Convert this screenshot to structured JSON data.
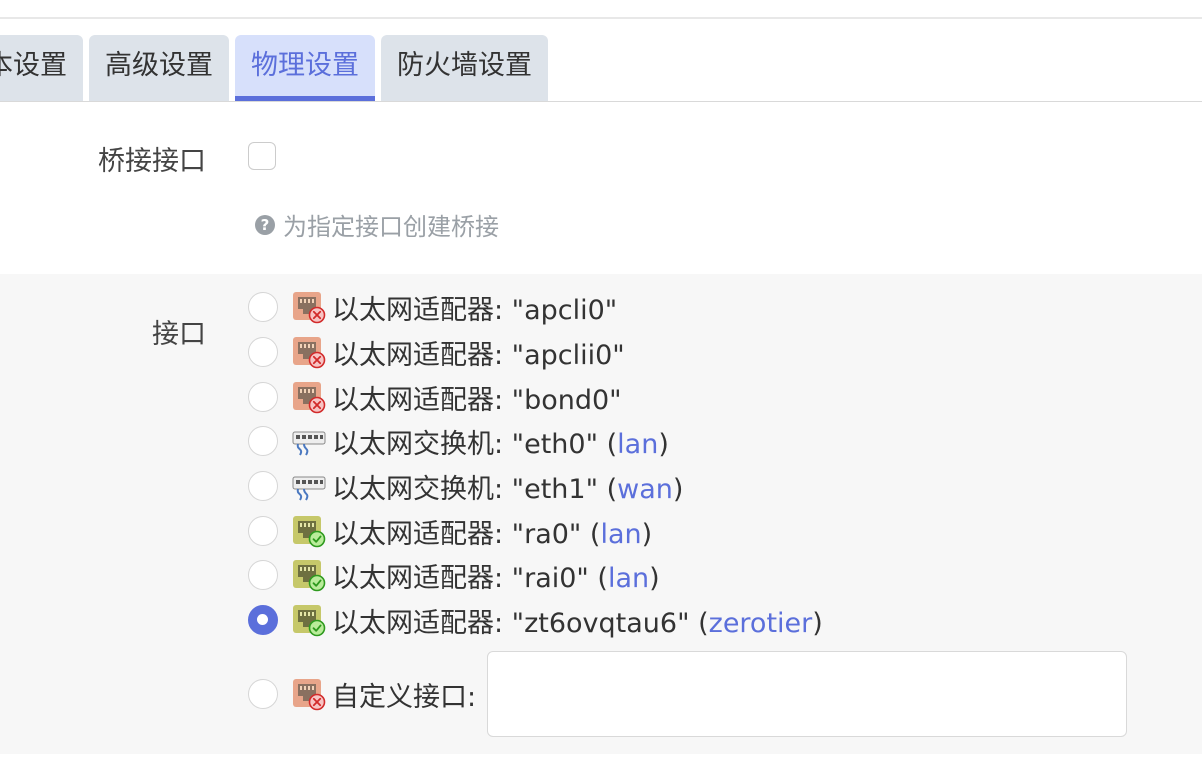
{
  "tabs": [
    {
      "label": "本设置",
      "active": false
    },
    {
      "label": "高级设置",
      "active": false
    },
    {
      "label": "物理设置",
      "active": true
    },
    {
      "label": "防火墙设置",
      "active": false
    }
  ],
  "bridge": {
    "label": "桥接接口",
    "checked": false,
    "help": "为指定接口创建桥接"
  },
  "interface": {
    "label": "接口",
    "options": [
      {
        "text": "以太网适配器: \"apcli0\"",
        "zone": "",
        "icon": "ethernet-adapter-down-icon",
        "checked": false
      },
      {
        "text": "以太网适配器: \"apclii0\"",
        "zone": "",
        "icon": "ethernet-adapter-down-icon",
        "checked": false
      },
      {
        "text": "以太网适配器: \"bond0\"",
        "zone": "",
        "icon": "ethernet-adapter-down-icon",
        "checked": false
      },
      {
        "text": "以太网交换机: \"eth0\"",
        "zone": "lan",
        "icon": "ethernet-switch-icon",
        "checked": false
      },
      {
        "text": "以太网交换机: \"eth1\"",
        "zone": "wan",
        "icon": "ethernet-switch-icon",
        "checked": false
      },
      {
        "text": "以太网适配器: \"ra0\"",
        "zone": "lan",
        "icon": "ethernet-adapter-up-icon",
        "checked": false
      },
      {
        "text": "以太网适配器: \"rai0\"",
        "zone": "lan",
        "icon": "ethernet-adapter-up-icon",
        "checked": false
      },
      {
        "text": "以太网适配器: \"zt6ovqtau6\"",
        "zone": "zerotier",
        "icon": "ethernet-adapter-up-icon",
        "checked": true
      }
    ],
    "custom": {
      "label": "自定义接口:",
      "icon": "ethernet-adapter-down-icon",
      "value": "",
      "checked": false
    }
  },
  "colors": {
    "accent": "#5b6fdb",
    "tab_bg": "#dde3ea",
    "tab_active_bg": "#d7e0fb",
    "section_bg": "#f7f7f7"
  }
}
